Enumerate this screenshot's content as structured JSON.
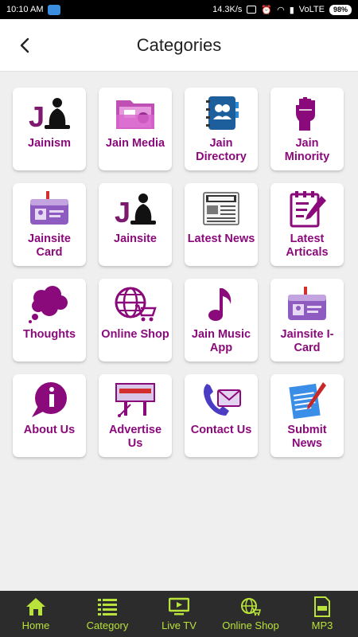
{
  "status_bar": {
    "time": "10:10 AM",
    "speed": "14.3K/s",
    "network": "VoLTE",
    "battery": "98%"
  },
  "header": {
    "title": "Categories"
  },
  "categories": [
    {
      "label": "Jainism",
      "icon": "jainism-logo-icon"
    },
    {
      "label": "Jain Media",
      "icon": "folder-media-icon"
    },
    {
      "label": "Jain Directory",
      "icon": "contact-book-icon"
    },
    {
      "label": "Jain Minority",
      "icon": "raised-fist-icon"
    },
    {
      "label": "Jainsite Card",
      "icon": "id-card-icon"
    },
    {
      "label": "Jainsite",
      "icon": "jainsite-logo-icon"
    },
    {
      "label": "Latest News",
      "icon": "newspaper-icon"
    },
    {
      "label": "Latest Articals",
      "icon": "notepad-pencil-icon"
    },
    {
      "label": "Thoughts",
      "icon": "thought-bubble-icon"
    },
    {
      "label": "Online Shop",
      "icon": "globe-cart-icon"
    },
    {
      "label": "Jain Music App",
      "icon": "music-note-icon"
    },
    {
      "label": "Jainsite I-Card",
      "icon": "id-card-icon"
    },
    {
      "label": "About Us",
      "icon": "info-bubble-icon"
    },
    {
      "label": "Advertise Us",
      "icon": "billboard-icon"
    },
    {
      "label": "Contact Us",
      "icon": "phone-envelope-icon"
    },
    {
      "label": "Submit News",
      "icon": "notepad-pen-icon"
    }
  ],
  "bottom_nav": [
    {
      "label": "Home",
      "icon": "home-icon"
    },
    {
      "label": "Category",
      "icon": "list-icon"
    },
    {
      "label": "Live TV",
      "icon": "tv-icon"
    },
    {
      "label": "Online Shop",
      "icon": "globe-cart-icon"
    },
    {
      "label": "MP3",
      "icon": "mp3-file-icon"
    }
  ],
  "colors": {
    "accent": "#8b0a7b",
    "nav_label": "#b9e33a",
    "nav_bg": "#2c2c2c"
  }
}
